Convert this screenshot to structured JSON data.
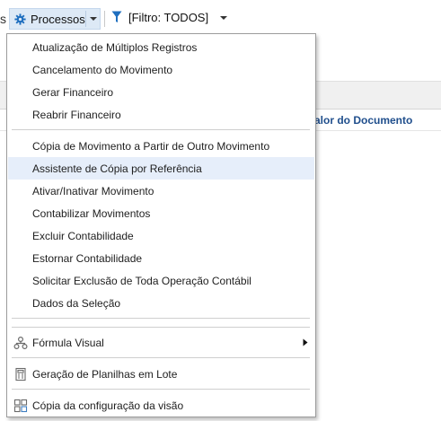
{
  "toolbar": {
    "left_stub": "s",
    "processos_label": "Processos",
    "filter_label": "[Filtro: TODOS]"
  },
  "grid": {
    "column_header": "alor do Documento"
  },
  "menu": {
    "group1": [
      "Atualização de Múltiplos Registros",
      "Cancelamento do Movimento",
      "Gerar Financeiro",
      "Reabrir Financeiro"
    ],
    "group2": [
      "Cópia de Movimento a Partir de Outro Movimento",
      "Assistente de Cópia por Referência",
      "Ativar/Inativar Movimento",
      "Contabilizar Movimentos",
      "Excluir Contabilidade",
      "Estornar Contabilidade",
      "Solicitar Exclusão de Toda Operação Contábil",
      "Dados da Seleção"
    ],
    "formula_visual": "Fórmula Visual",
    "geracao_planilhas": "Geração de Planilhas em Lote",
    "copia_configuracao": "Cópia da configuração da visão",
    "highlighted_item": "Assistente de Cópia por Referência"
  },
  "colors": {
    "accent": "#1f6fbf",
    "header_text": "#1f4e8c",
    "highlight": "#e6eefa"
  }
}
